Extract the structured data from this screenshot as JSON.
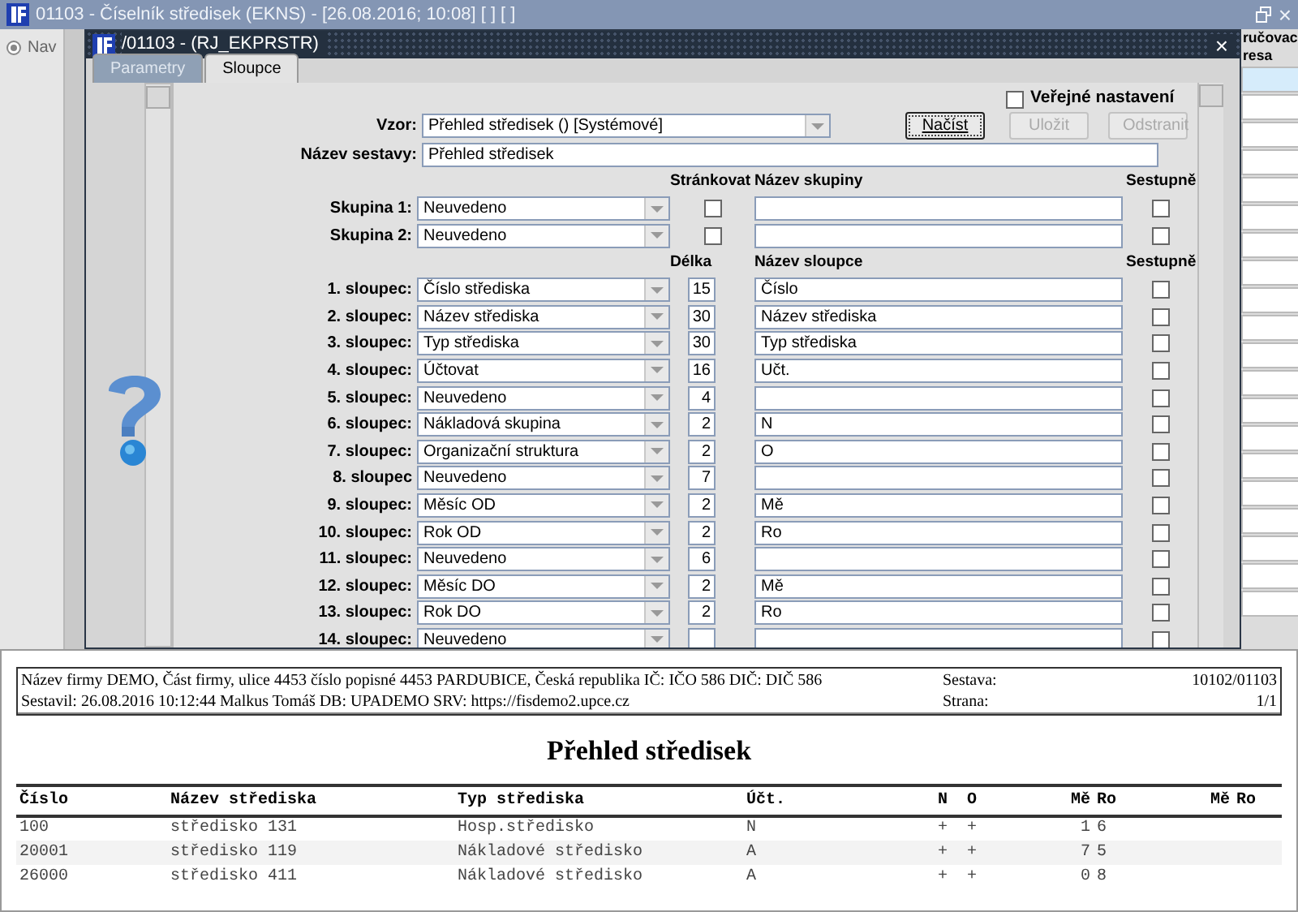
{
  "app_title": "01103 - Číselník středisek (EKNS) - [26.08.2016; 10:08]  [ ]  [ ]",
  "app_close": "×",
  "nav_label": "Nav",
  "right_grid": {
    "header_lines": [
      "ručovac",
      "resa"
    ],
    "rows": [
      {
        "selected": true
      },
      {
        "selected": false
      },
      {
        "selected": false
      },
      {
        "selected": false
      },
      {
        "selected": false
      },
      {
        "selected": false
      },
      {
        "selected": false
      },
      {
        "selected": false
      },
      {
        "selected": false
      },
      {
        "selected": false
      },
      {
        "selected": false
      },
      {
        "selected": false
      },
      {
        "selected": false
      },
      {
        "selected": false
      },
      {
        "selected": false
      },
      {
        "selected": false
      },
      {
        "selected": false
      },
      {
        "selected": false
      },
      {
        "selected": false
      },
      {
        "selected": false
      }
    ]
  },
  "dialog": {
    "title": "/01103 - (RJ_EKPRSTR)",
    "close": "×",
    "tabs": [
      {
        "label": "Parametry",
        "selected": false
      },
      {
        "label": "Sloupce",
        "selected": true
      }
    ],
    "public_settings": {
      "label": "Veřejné nastavení",
      "checked": false
    },
    "template": {
      "label": "Vzor:",
      "value": "Přehled středisek   ()   [Systémové]"
    },
    "buttons": [
      {
        "label": "Načíst",
        "disabled": false
      },
      {
        "label": "Uložit",
        "disabled": true
      },
      {
        "label": "Odstranit",
        "disabled": true
      }
    ],
    "report_name": {
      "label": "Název sestavy:",
      "value": "Přehled středisek"
    },
    "group_headers": [
      "Stránkovat",
      "Název skupiny",
      "Sestupně"
    ],
    "groups": [
      {
        "label": "Skupina 1:",
        "value": "Neuvedeno",
        "paginate": false,
        "descending": false
      },
      {
        "label": "Skupina 2:",
        "value": "Neuvedeno",
        "paginate": false,
        "descending": false
      }
    ],
    "column_headers": [
      "Délka",
      "Název sloupce",
      "Sestupně"
    ],
    "columns": [
      {
        "label": "1. sloupec:",
        "value": "Číslo střediska",
        "length": "15",
        "name": "Číslo",
        "descending": false
      },
      {
        "label": "2. sloupec:",
        "value": "Název střediska",
        "length": "30",
        "name": "Název střediska",
        "descending": false
      },
      {
        "label": "3. sloupec:",
        "value": "Typ střediska",
        "length": "30",
        "name": "Typ střediska",
        "descending": false
      },
      {
        "label": "4. sloupec:",
        "value": "Účtovat",
        "length": "16",
        "name": "Učt.",
        "descending": false
      },
      {
        "label": "5. sloupec:",
        "value": "Neuvedeno",
        "length": "4",
        "descending": false
      },
      {
        "label": "6. sloupec:",
        "value": "Nákladová skupina",
        "length": "2",
        "name": "N",
        "descending": false
      },
      {
        "label": "7. sloupec:",
        "value": "Organizační struktura",
        "length": "2",
        "name": "O",
        "descending": false
      },
      {
        "label": "8. sloupec",
        "value": "Neuvedeno",
        "length": "7",
        "descending": false
      },
      {
        "label": "9. sloupec:",
        "value": "Měsíc OD",
        "length": "2",
        "name": "Mě",
        "descending": false
      },
      {
        "label": "10. sloupec:",
        "value": "Rok OD",
        "length": "2",
        "name": "Ro",
        "descending": false
      },
      {
        "label": "11. sloupec:",
        "value": "Neuvedeno",
        "length": "6",
        "descending": false
      },
      {
        "label": "12. sloupec:",
        "value": "Měsíc DO",
        "length": "2",
        "name": "Mě",
        "descending": false
      },
      {
        "label": "13. sloupec:",
        "value": "Rok DO",
        "length": "2",
        "name": "Ro",
        "descending": false
      },
      {
        "label": "14. sloupec:",
        "value": "Neuvedeno",
        "descending": false
      }
    ]
  },
  "report": {
    "company_line": "Název firmy DEMO, Část firmy, ulice 4453 číslo popisné 4453 PARDUBICE, Česká republika  IČ: IČO 586  DIČ: DIČ 586",
    "author_line": "Sestavil: 26.08.2016 10:12:44 Malkus Tomáš  DB: UPADEMO  SRV: https://fisdemo2.upce.cz",
    "meta": [
      {
        "label": "Sestava:",
        "value": "10102/01103"
      },
      {
        "label": "Strana:",
        "value": "1/1"
      }
    ],
    "title": "Přehled středisek",
    "columns": [
      "Číslo",
      "Název střediska",
      "Typ střediska",
      "Účt.",
      "N",
      "O",
      "Mě",
      "Ro",
      "Mě",
      "Ro"
    ],
    "rows": [
      [
        "100",
        "středisko 131",
        "Hosp.středisko",
        "N",
        "+",
        "+",
        "1",
        "6",
        "",
        ""
      ],
      [
        "20001",
        "středisko 119",
        "Nákladové středisko",
        "A",
        "+",
        "+",
        "7",
        "5",
        "",
        ""
      ],
      [
        "26000",
        "středisko 411",
        "Nákladové středisko",
        "A",
        "+",
        "+",
        "0",
        "8",
        "",
        ""
      ]
    ]
  }
}
